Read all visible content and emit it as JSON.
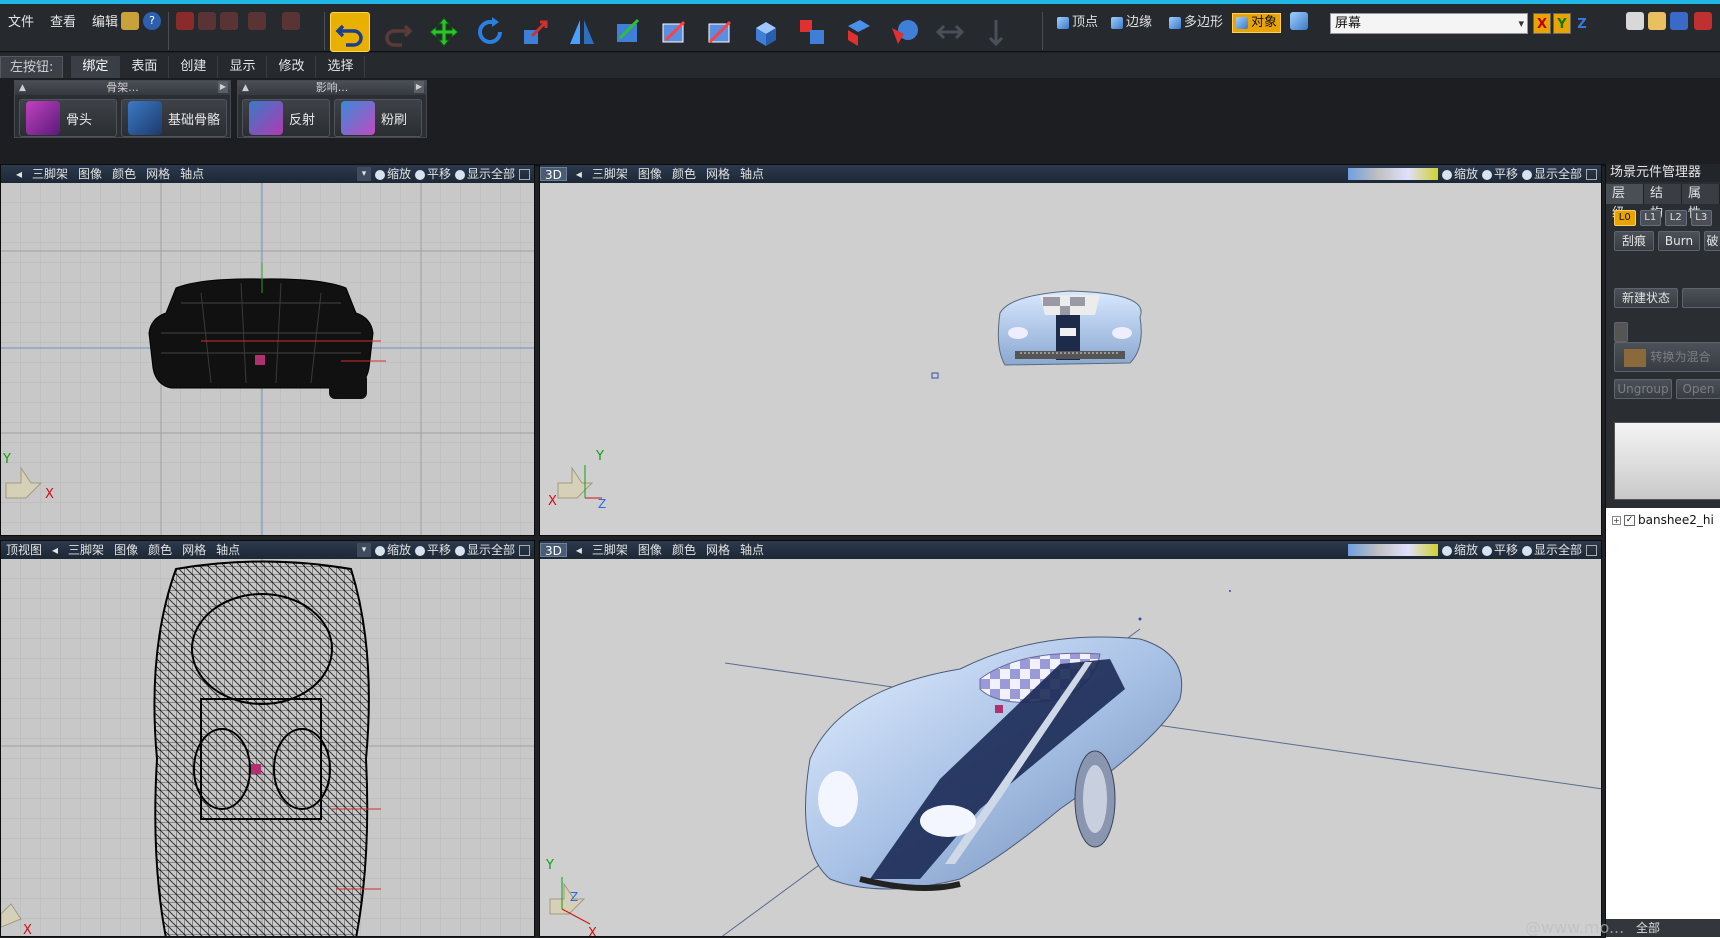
{
  "menu": [
    "文件",
    "查看",
    "编辑"
  ],
  "selection_modes": [
    {
      "label": "顶点",
      "active": false
    },
    {
      "label": "边缘",
      "active": false
    },
    {
      "label": "多边形",
      "active": false
    },
    {
      "label": "对象",
      "active": true
    }
  ],
  "screen_select": "屏幕",
  "axes": [
    "X",
    "Y",
    "Z"
  ],
  "ribbon_tabs": [
    {
      "label": "左按钮:",
      "kind": "quick"
    },
    {
      "label": "绑定",
      "active": true
    },
    {
      "label": "表面"
    },
    {
      "label": "创建"
    },
    {
      "label": "显示"
    },
    {
      "label": "修改"
    },
    {
      "label": "选择"
    }
  ],
  "ribbon_groups": [
    {
      "title": "骨架...",
      "buttons": [
        "骨头",
        "基础骨骼"
      ]
    },
    {
      "title": "影响...",
      "buttons": [
        "反射",
        "粉刷"
      ]
    }
  ],
  "viewport_menu": [
    "三脚架",
    "图像",
    "颜色",
    "网格",
    "轴点"
  ],
  "viewport_nav": [
    "缩放",
    "平移",
    "显示全部"
  ],
  "viewports": {
    "front_left": {
      "mode": "",
      "title": ""
    },
    "front_3d": {
      "mode": "3D"
    },
    "top_left": {
      "mode": "",
      "title": "顶视图"
    },
    "persp_3d": {
      "mode": "3D"
    }
  },
  "left_top_mode": "",
  "left_bottom_mode": "顶视图",
  "scene_panel": {
    "title": "场景元件管理器",
    "tabs": [
      "层级",
      "结构",
      "属性"
    ],
    "levels": [
      "L0",
      "L1",
      "L2",
      "L3"
    ],
    "row1": [
      "刮痕",
      "Burn",
      "破"
    ],
    "new_state": "新建状态",
    "convert": "转换为混合",
    "ungroup": "Ungroup",
    "open": "Open",
    "tree_item": "banshee2_hi",
    "bottom": "全部"
  },
  "watermark": "@www.mo...",
  "colors": {
    "accent": "#e8a400",
    "title_bar": "#22b8e6",
    "viewport_bg": "#c8c8c8",
    "axis_x": "#d01010",
    "axis_y": "#10a010"
  }
}
